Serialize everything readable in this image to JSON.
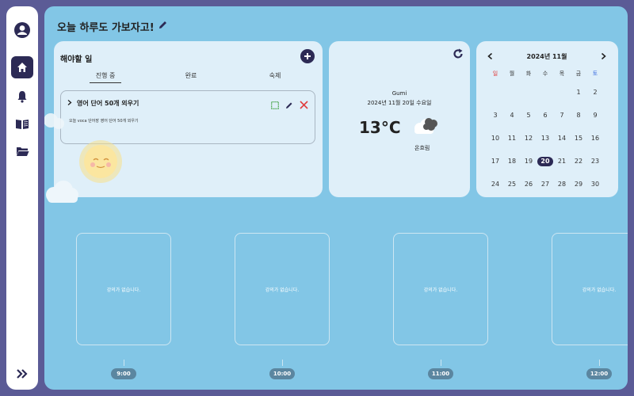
{
  "sidebar": {
    "items": [
      {
        "icon": "avatar-icon",
        "label": ""
      },
      {
        "icon": "home-icon",
        "active": true
      },
      {
        "icon": "bell-icon"
      },
      {
        "icon": "book-icon"
      },
      {
        "icon": "folder-icon"
      }
    ],
    "expand_icon": "double-chevron-right-icon"
  },
  "header": {
    "title": "오늘 하루도 가보자고!",
    "edit_icon": "pencil-icon"
  },
  "todo": {
    "title": "해야할 일",
    "tabs": [
      "진행 중",
      "완료",
      "숙제"
    ],
    "active_tab": "진행 중",
    "tasks": [
      {
        "title": "영어 단어 50개 외우기",
        "description": "오늘 voca 단어장 영어 단어 50개 외우기"
      }
    ]
  },
  "weather": {
    "city": "Gumi",
    "date": "2024년 11월 20일 수요일",
    "temperature": "13°C",
    "description": "온흐림",
    "icon": "cloudy-icon"
  },
  "calendar": {
    "month_label": "2024년 11월",
    "weekdays": [
      "일",
      "월",
      "화",
      "수",
      "목",
      "금",
      "토"
    ],
    "days": [
      "1",
      "2",
      "3",
      "4",
      "5",
      "6",
      "7",
      "8",
      "9",
      "10",
      "11",
      "12",
      "13",
      "14",
      "15",
      "16",
      "17",
      "18",
      "19",
      "20",
      "21",
      "22",
      "23",
      "24",
      "25",
      "26",
      "27",
      "28",
      "29",
      "30"
    ],
    "today": "20",
    "colors": {
      "sunday": "#e03c3c",
      "saturday": "#3c6ee0",
      "today_bg": "#2c2a55"
    }
  },
  "schedule": {
    "slots": [
      {
        "empty_text": "강의가 없습니다.",
        "time": "9:00"
      },
      {
        "empty_text": "강의가 없습니다.",
        "time": "10:00"
      },
      {
        "empty_text": "강의가 없습니다.",
        "time": "11:00"
      },
      {
        "empty_text": "강의가 없습니다.",
        "time": "12:00"
      }
    ]
  },
  "colors": {
    "accent": "#2c2a55",
    "background": "#82c6e6",
    "frame": "#5b5b96"
  }
}
